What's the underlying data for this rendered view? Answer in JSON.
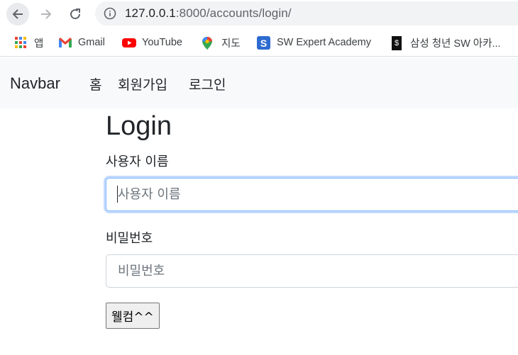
{
  "browser": {
    "url_host": "127.0.0.1",
    "url_rest": ":8000/accounts/login/",
    "icons": {
      "back": "back-arrow-icon",
      "forward": "forward-arrow-icon",
      "reload": "reload-icon",
      "info": "info-icon"
    }
  },
  "bookmarks": [
    {
      "label": "앱",
      "icon": "apps-grid-icon"
    },
    {
      "label": "Gmail",
      "icon": "gmail-icon"
    },
    {
      "label": "YouTube",
      "icon": "youtube-icon"
    },
    {
      "label": "지도",
      "icon": "maps-pin-icon"
    },
    {
      "label": "SW Expert Academy",
      "icon": "swea-icon"
    },
    {
      "label": "삼성 청년 SW 아카...",
      "icon": "ssafy-icon"
    }
  ],
  "navbar": {
    "brand": "Navbar",
    "links": [
      "홈",
      "회원가입",
      "로그인"
    ],
    "background": "#f8f9fa"
  },
  "form": {
    "title": "Login",
    "username_label": "사용자 이름",
    "username_placeholder": "사용자 이름",
    "username_value": "",
    "password_label": "비밀번호",
    "password_placeholder": "비밀번호",
    "password_value": "",
    "submit_label": "웰컴^^"
  },
  "colors": {
    "focus_ring": "#86b7fe",
    "input_border": "#ced4da",
    "text": "#212529"
  }
}
